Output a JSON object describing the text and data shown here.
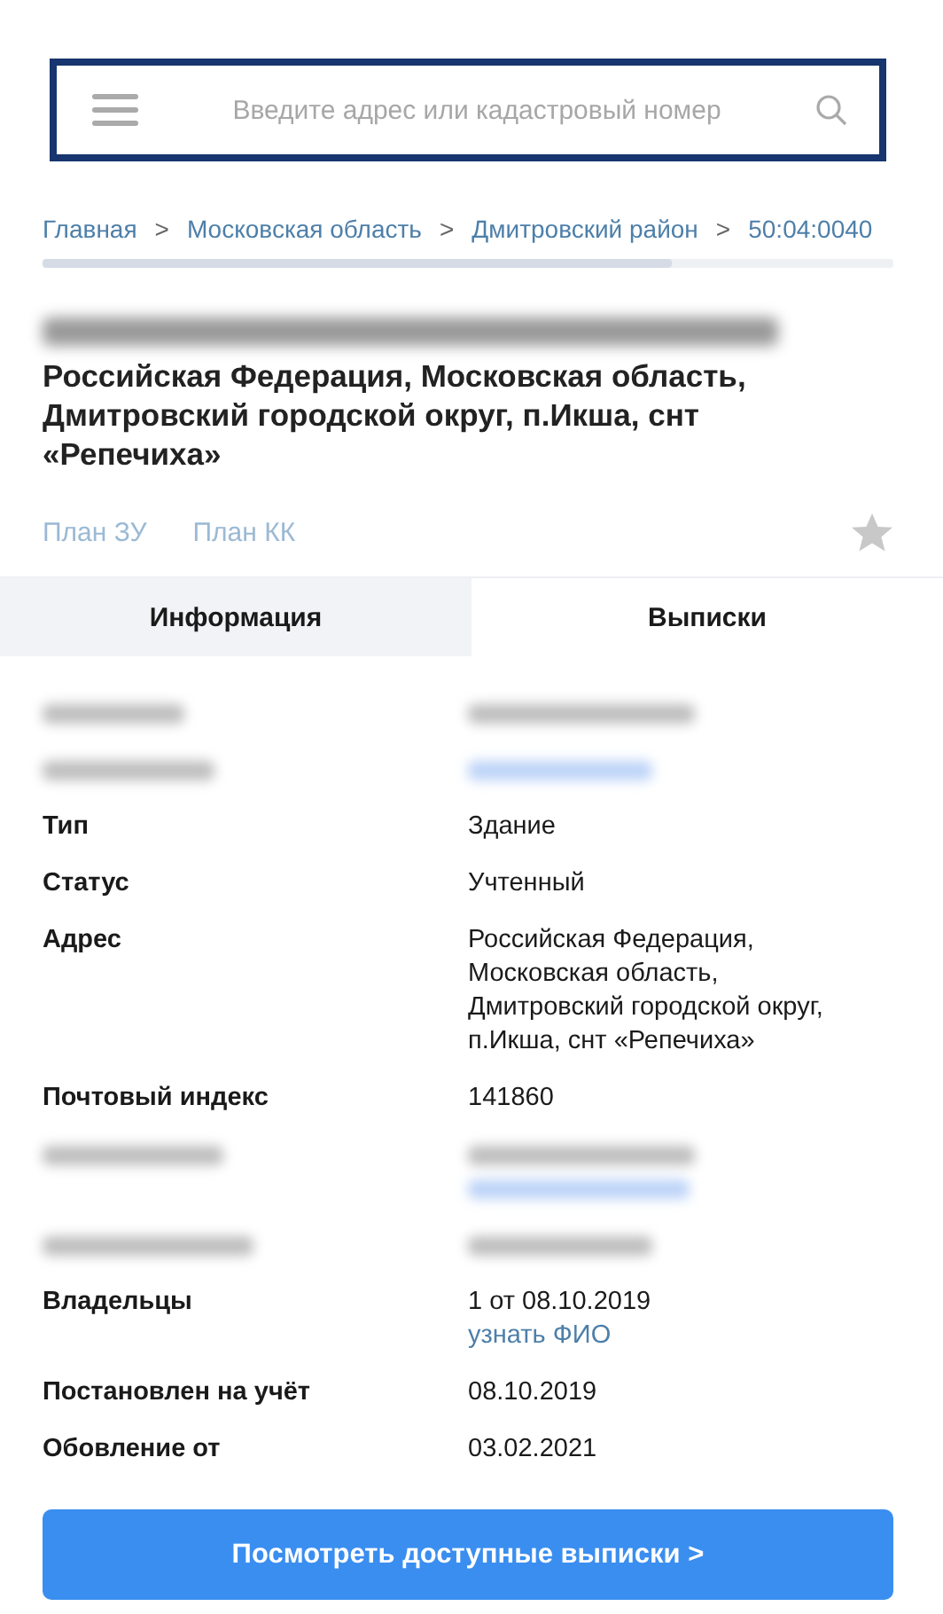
{
  "search": {
    "placeholder": "Введите адрес или кадастровый номер"
  },
  "breadcrumbs": [
    "Главная",
    "Московская область",
    "Дмитровский район",
    "50:04:0040"
  ],
  "breadcrumb_separator": ">",
  "title": {
    "blurred_first_line": true,
    "text": "Российская Федерация, Московская область, Дмитровский городской округ, п.Икша, снт «Репечиха»"
  },
  "plan_links": [
    {
      "label": "План ЗУ",
      "disabled": true
    },
    {
      "label": "План КК",
      "disabled": true
    }
  ],
  "favorite": {
    "starred": false
  },
  "tabs": [
    {
      "label": "Информация",
      "selected": true
    },
    {
      "label": "Выписки",
      "selected": false
    }
  ],
  "rows": [
    {
      "kind": "blurred",
      "value_link": false,
      "extra_link": false
    },
    {
      "kind": "blurred",
      "value_link": true,
      "extra_link": false
    },
    {
      "kind": "field",
      "label": "Тип",
      "value": "Здание"
    },
    {
      "kind": "field",
      "label": "Статус",
      "value": "Учтенный"
    },
    {
      "kind": "field",
      "label": "Адрес",
      "value": "Российская Федерация, Московская область, Дмитровский городской округ, п.Икша, снт «Репечиха»"
    },
    {
      "kind": "field",
      "label": "Почтовый индекс",
      "value": "141860"
    },
    {
      "kind": "blurred",
      "value_link": false,
      "extra_link": true
    },
    {
      "kind": "blurred",
      "value_link": false,
      "extra_link": false
    },
    {
      "kind": "field",
      "label": "Владельцы",
      "value": "1 от 08.10.2019",
      "link": "узнать ФИО"
    },
    {
      "kind": "field",
      "label": "Постановлен на учёт",
      "value": "08.10.2019"
    },
    {
      "kind": "field",
      "label": "Обовление от",
      "value": "03.02.2021"
    }
  ],
  "cta": {
    "label": "Посмотреть доступные выписки >"
  }
}
